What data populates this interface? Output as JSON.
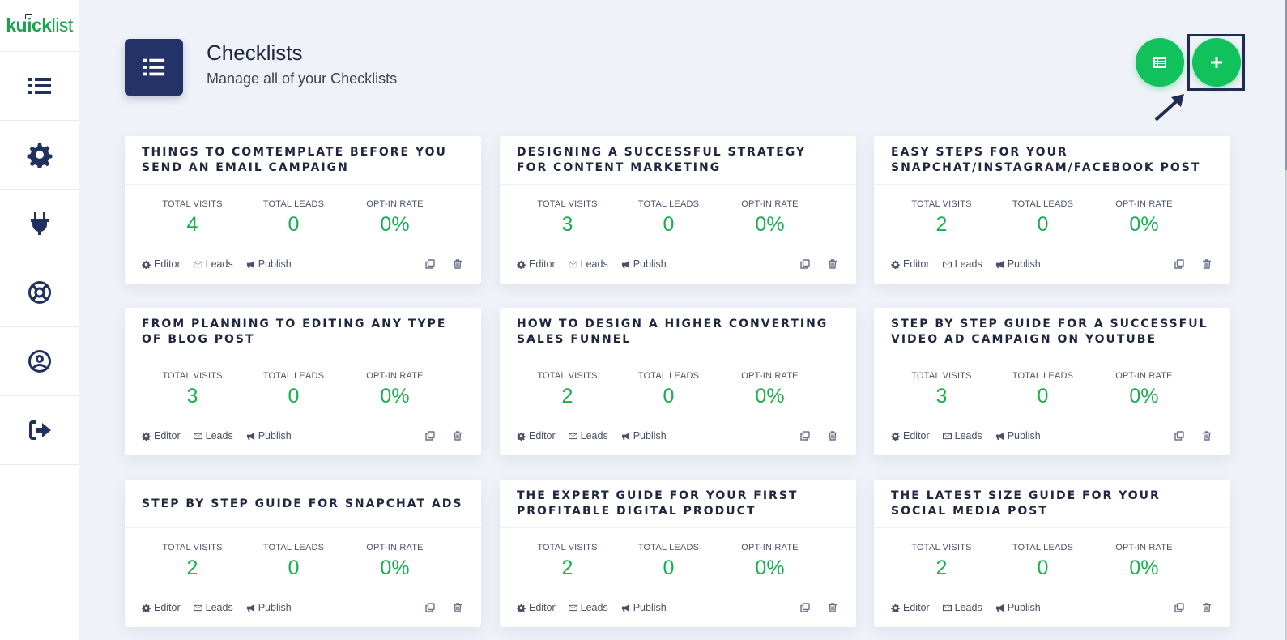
{
  "app": {
    "logo_kuick": "kuick",
    "logo_list": "list"
  },
  "sidebar": {
    "items": [
      {
        "icon": "list-icon"
      },
      {
        "icon": "gear-icon"
      },
      {
        "icon": "plug-icon"
      },
      {
        "icon": "life-ring-icon"
      },
      {
        "icon": "user-circle-icon"
      },
      {
        "icon": "sign-out-icon"
      }
    ]
  },
  "header": {
    "title": "Checklists",
    "subtitle": "Manage all of your Checklists"
  },
  "colors": {
    "accent": "#11c15c",
    "navy": "#233267",
    "stat_value": "#18b04e"
  },
  "labels": {
    "total_visits": "TOTAL VISITS",
    "total_leads": "TOTAL LEADS",
    "optin_rate": "OPT-IN RATE",
    "editor": "Editor",
    "leads": "Leads",
    "publish": "Publish"
  },
  "cards": [
    {
      "title": "THINGS TO COMTEMPLATE BEFORE YOU SEND AN EMAIL CAMPAIGN",
      "visits": "4",
      "leads": "0",
      "rate": "0%"
    },
    {
      "title": "DESIGNING A SUCCESSFUL STRATEGY FOR CONTENT MARKETING",
      "visits": "3",
      "leads": "0",
      "rate": "0%"
    },
    {
      "title": "EASY STEPS FOR YOUR SNAPCHAT/INSTAGRAM/FACEBOOK POST",
      "visits": "2",
      "leads": "0",
      "rate": "0%"
    },
    {
      "title": "FROM PLANNING TO EDITING ANY TYPE OF BLOG POST",
      "visits": "3",
      "leads": "0",
      "rate": "0%"
    },
    {
      "title": "HOW TO DESIGN A HIGHER CONVERTING SALES FUNNEL",
      "visits": "2",
      "leads": "0",
      "rate": "0%"
    },
    {
      "title": "STEP BY STEP GUIDE FOR A SUCCESSFUL VIDEO AD CAMPAIGN ON YOUTUBE",
      "visits": "3",
      "leads": "0",
      "rate": "0%"
    },
    {
      "title": "STEP BY STEP GUIDE FOR SNAPCHAT ADS",
      "visits": "2",
      "leads": "0",
      "rate": "0%"
    },
    {
      "title": "THE EXPERT GUIDE FOR YOUR FIRST PROFITABLE DIGITAL PRODUCT",
      "visits": "2",
      "leads": "0",
      "rate": "0%"
    },
    {
      "title": "THE LATEST SIZE GUIDE FOR YOUR SOCIAL MEDIA POST",
      "visits": "2",
      "leads": "0",
      "rate": "0%"
    }
  ]
}
